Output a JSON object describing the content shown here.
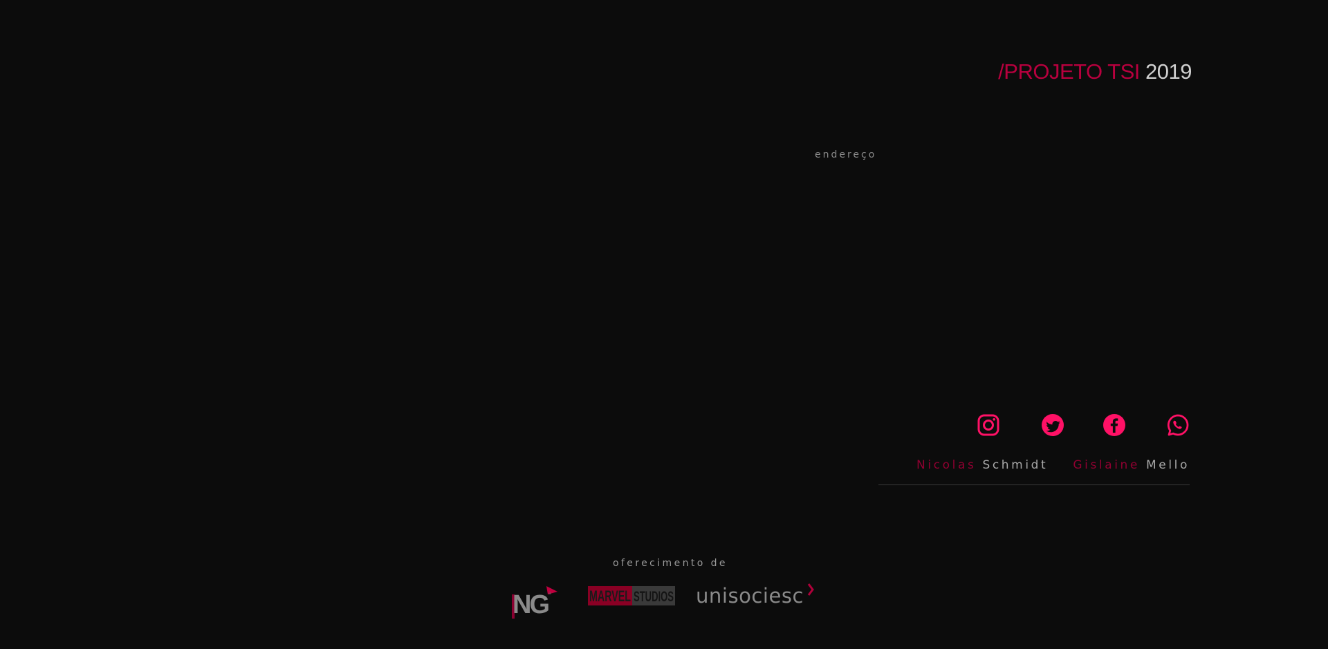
{
  "header": {
    "title_slash": "/",
    "title_project": "PROJETO TSI",
    "title_year": "2019"
  },
  "contact": {
    "address_label": "endereço"
  },
  "socials": [
    {
      "name": "instagram",
      "icon": "instagram-icon"
    },
    {
      "name": "twitter",
      "icon": "twitter-icon"
    },
    {
      "name": "facebook",
      "icon": "facebook-icon"
    },
    {
      "name": "whatsapp",
      "icon": "whatsapp-icon"
    }
  ],
  "authors": [
    {
      "first": "Nicolas",
      "last": "Schmidt"
    },
    {
      "first": "Gislaine",
      "last": "Mello"
    }
  ],
  "sponsors": {
    "label": "oferecimento de",
    "logos": [
      {
        "name": "NG",
        "icon": "ng-logo"
      },
      {
        "name": "MARVEL STUDIOS",
        "icon": "marvel-studios-logo",
        "parts": [
          "MARVEL",
          "STUDIOS"
        ]
      },
      {
        "name": "unisociesc",
        "icon": "unisociesc-logo"
      }
    ]
  },
  "colors": {
    "background": "#0c0c0c",
    "accent": "#ff1166",
    "accent_dark": "#b8003e",
    "text": "#bdbdbd"
  }
}
